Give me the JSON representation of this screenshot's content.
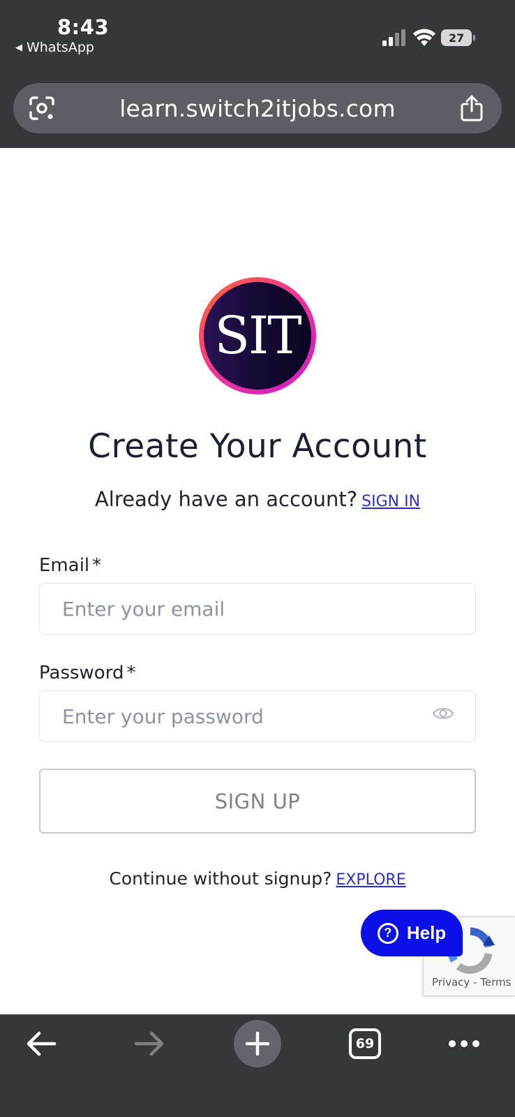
{
  "status_bar": {
    "time": "8:43",
    "back_app": "WhatsApp",
    "battery": "27"
  },
  "browser": {
    "url": "learn.switch2itjobs.com",
    "tabs_count": "69"
  },
  "logo": {
    "text": "SIT"
  },
  "form": {
    "title": "Create Your Account",
    "signin_prompt": "Already have an account?",
    "signin_link": "SIGN IN",
    "email_label": "Email",
    "email_placeholder": "Enter your email",
    "password_label": "Password",
    "password_placeholder": "Enter your password",
    "required_mark": "*",
    "signup_button": "SIGN UP",
    "explore_prompt": "Continue without signup?",
    "explore_link": "EXPLORE"
  },
  "help_widget": {
    "label": "Help"
  },
  "recaptcha": {
    "privacy": "Privacy",
    "separator": "-",
    "terms": "Terms"
  },
  "colors": {
    "chrome": "#35373b",
    "link": "#2a2fc9",
    "help_button": "#0b10e6"
  }
}
